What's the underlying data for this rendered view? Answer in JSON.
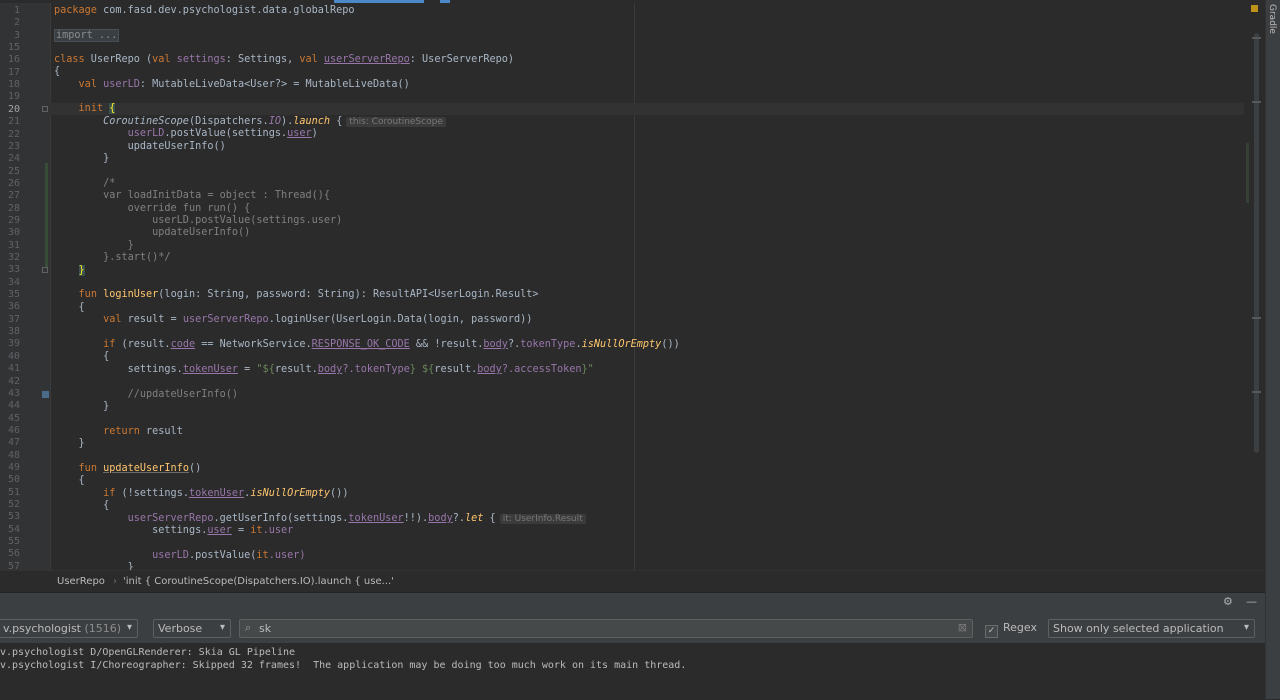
{
  "editor": {
    "line_numbers": [
      "1",
      "2",
      "3",
      "15",
      "16",
      "17",
      "18",
      "19",
      "20",
      "21",
      "22",
      "23",
      "24",
      "25",
      "26",
      "27",
      "28",
      "29",
      "30",
      "31",
      "32",
      "33",
      "34",
      "35",
      "36",
      "37",
      "38",
      "39",
      "40",
      "41",
      "42",
      "43",
      "44",
      "45",
      "46",
      "47",
      "48",
      "49",
      "50",
      "51",
      "52",
      "53",
      "54",
      "55",
      "56",
      "57"
    ],
    "current_line": "20",
    "code": {
      "l1_kw": "package",
      "l1_rest": " com.fasd.dev.psychologist.data.globalRepo",
      "l3_fold": "import ...",
      "l15_kw1": "class",
      "l15_name": " UserRepo (",
      "l15_kw2": "val",
      "l15_p1": " settings",
      "l15_t1": ": Settings, ",
      "l15_kw3": "val",
      "l15_p2": "userServerRepo",
      "l15_t2": ": UserServerRepo)",
      "l16": "{",
      "l17_kw": "val",
      "l17_p": " userLD",
      "l17_rest": ": MutableLiveData<User?> = MutableLiveData()",
      "l19_kw": "init",
      "l19_brace": "{",
      "l20_a": "CoroutineScope",
      "l20_b": "(Dispatchers.",
      "l20_io": "IO",
      "l20_c": ").",
      "l20_launch": "launch",
      "l20_d": " {",
      "l20_hint": "this: CoroutineScope",
      "l21_a": "userLD",
      "l21_b": ".postValue(settings.",
      "l21_user": "user",
      "l21_c": ")",
      "l22": "updateUserInfo()",
      "l23": "}",
      "l25": "/*",
      "l26": "var loadInitData = object : Thread(){",
      "l27": "override fun run() {",
      "l28": "userLD.postValue(settings.user)",
      "l29": "updateUserInfo()",
      "l30": "}",
      "l31": "}.start()*/",
      "l32": "}",
      "l34_kw": "fun",
      "l34_fn": "loginUser",
      "l34_rest": "(login: String, password: String): ResultAPI<UserLogin.Result>",
      "l35": "{",
      "l36_kw": "val",
      "l36_rest": " result = ",
      "l36_repo": "userServerRepo",
      "l36_end": ".loginUser(UserLogin.Data(login, password))",
      "l38_kw": "if",
      "l38_a": " (result.",
      "l38_code": "code",
      "l38_b": " == NetworkService.",
      "l38_const": "RESPONSE_OK_CODE",
      "l38_c": " && !result.",
      "l38_body": "body",
      "l38_d": "?.",
      "l38_tt": "tokenType",
      "l38_e": ".",
      "l38_fn": "isNullOrEmpty",
      "l38_f": "())",
      "l39": "{",
      "l40_a": "settings.",
      "l40_tu": "tokenUser",
      "l40_b": " = ",
      "l40_s1": "\"${",
      "l40_r1": "result.",
      "l40_body1": "body",
      "l40_r2": "?.tokenType",
      "l40_s2": "} ${",
      "l40_r3": "result.",
      "l40_body2": "body",
      "l40_r4": "?.accessToken",
      "l40_s3": "}\"",
      "l42": "//updateUserInfo()",
      "l43": "}",
      "l45_kw": "return",
      "l45_rest": " result",
      "l46": "}",
      "l48_kw": "fun",
      "l48_fn": "updateUserInfo",
      "l48_rest": "()",
      "l49": "{",
      "l50_kw": "if",
      "l50_a": " (!settings.",
      "l50_tu": "tokenUser",
      "l50_b": ".",
      "l50_fn": "isNullOrEmpty",
      "l50_c": "())",
      "l51": "{",
      "l52_a": "userServerRepo",
      "l52_b": ".getUserInfo(settings.",
      "l52_tu": "tokenUser",
      "l52_c": "!!).",
      "l52_body": "body",
      "l52_d": "?.",
      "l52_let": "let",
      "l52_e": " {",
      "l52_hint": "it: UserInfo.Result",
      "l53_a": "settings.",
      "l53_user": "user",
      "l53_b": " = ",
      "l53_it": "it",
      "l53_c": ".user",
      "l55_a": "userLD",
      "l55_b": ".postValue(",
      "l55_it": "it",
      "l55_c": ".user)",
      "l56": "}"
    }
  },
  "side_panel": {
    "gradle_label": "Gradle"
  },
  "breadcrumb": {
    "item1": "UserRepo",
    "sep": "›",
    "item2": "'init { CoroutineScope(Dispatchers.IO).launch { use...'"
  },
  "logcat": {
    "gear_icon": "⚙",
    "minimize_icon": "—",
    "process": "v.psychologist",
    "process_count": "(1516)",
    "level": "Verbose",
    "search_value": "sk",
    "regex_label": "Regex",
    "regex_checked": "✓",
    "filter": "Show only selected application",
    "lines": [
      "v.psychologist D/OpenGLRenderer: Skia GL Pipeline",
      "v.psychologist I/Choreographer: Skipped 32 frames!  The application may be doing too much work on its main thread."
    ]
  }
}
